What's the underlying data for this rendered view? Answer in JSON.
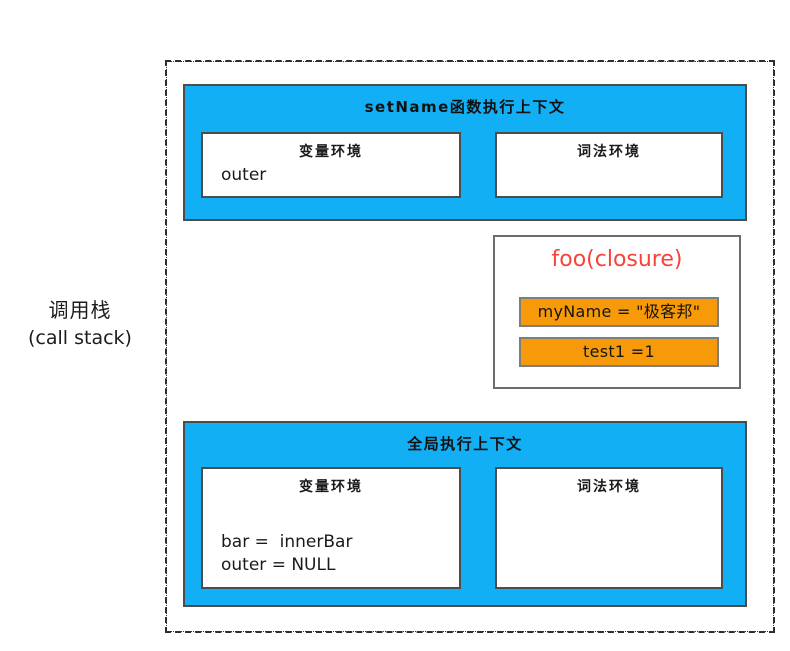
{
  "diagram": {
    "call_stack_label": {
      "cn": "调用栈",
      "en": "(call stack)"
    },
    "contexts": [
      {
        "id": "setname-context",
        "title": "setName函数执行上下文",
        "color": "#12AFF5",
        "variable_environment": {
          "title": "变量环境",
          "entries": "outer"
        },
        "lexical_environment": {
          "title": "词法环境",
          "entries": ""
        }
      },
      {
        "id": "global-context",
        "title": "全局执行上下文",
        "color": "#12AFF5",
        "variable_environment": {
          "title": "变量环境",
          "entries": "bar =  innerBar\nouter = NULL"
        },
        "lexical_environment": {
          "title": "词法环境",
          "entries": ""
        }
      }
    ],
    "closure": {
      "title": "foo(closure)",
      "title_color": "#F8433A",
      "item_color": "#F79A09",
      "items": [
        {
          "label": "myName = \"极客邦\""
        },
        {
          "label": "test1 =1"
        }
      ]
    }
  }
}
